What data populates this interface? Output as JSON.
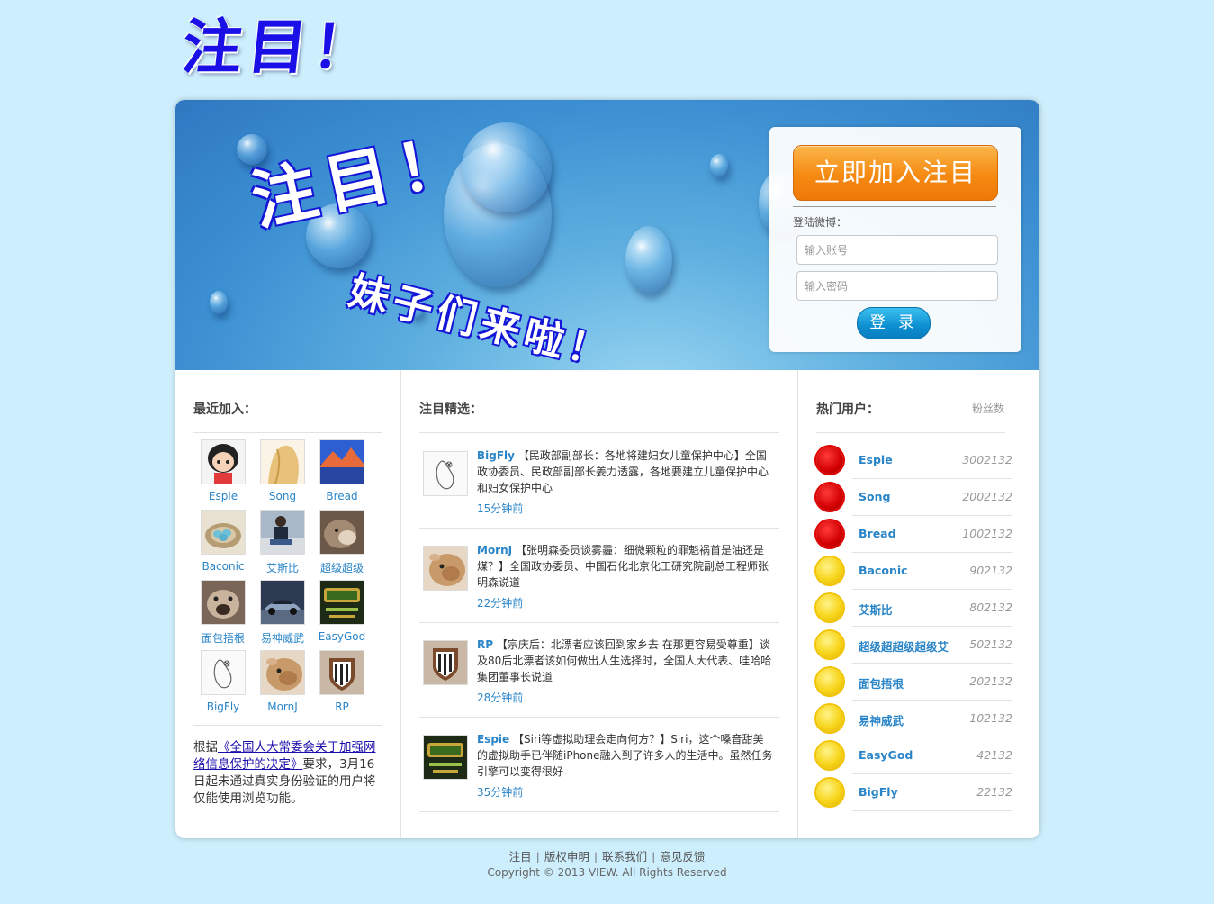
{
  "logo": {
    "text": "注目！"
  },
  "banner": {
    "title": "注目！",
    "subtitle": "妹子们来啦！"
  },
  "login": {
    "join_label": "立即加入注目",
    "section_label": "登陆微博：",
    "account_placeholder": "输入账号",
    "password_placeholder": "输入密码",
    "submit_label": "登 录"
  },
  "recent": {
    "title": "最近加入：",
    "users": [
      {
        "name": "Espie",
        "avatar": "cartoon-girl"
      },
      {
        "name": "Song",
        "avatar": "blonde-hair"
      },
      {
        "name": "Bread",
        "avatar": "mountain-lake"
      },
      {
        "name": "Baconic",
        "avatar": "blue-eggs-nest"
      },
      {
        "name": "艾斯比",
        "avatar": "person-sitting"
      },
      {
        "name": "超级超级",
        "avatar": "cat-closeup"
      },
      {
        "name": "面包捂根",
        "avatar": "dog-closeup"
      },
      {
        "name": "易神威武",
        "avatar": "sports-car"
      },
      {
        "name": "EasyGod",
        "avatar": "game-logo"
      },
      {
        "name": "BigFly",
        "avatar": "sketch-bird"
      },
      {
        "name": "MornJ",
        "avatar": "alpaca"
      },
      {
        "name": "RP",
        "avatar": "juventus-crest"
      }
    ],
    "notice_prefix": "根据",
    "notice_link": "《全国人大常委会关于加强网络信息保护的决定》",
    "notice_suffix": "要求，3月16日起未通过真实身份验证的用户将仅能使用浏览功能。"
  },
  "featured": {
    "title": "注目精选：",
    "posts": [
      {
        "author": "BigFly",
        "content": "【民政部副部长：各地将建妇女儿童保护中心】全国政协委员、民政部副部长姜力透露，各地要建立儿童保护中心和妇女保护中心",
        "time": "15分钟前",
        "avatar": "sketch-bird"
      },
      {
        "author": "MornJ",
        "content": "【张明森委员谈雾霾：细微颗粒的罪魁祸首是油还是煤？】全国政协委员、中国石化北京化工研究院副总工程师张明森说道",
        "time": "22分钟前",
        "avatar": "alpaca"
      },
      {
        "author": "RP",
        "content": "【宗庆后：北漂者应该回到家乡去 在那更容易受尊重】谈及80后北漂者该如何做出人生选择时，全国人大代表、哇哈哈集团董事长说道",
        "time": "28分钟前",
        "avatar": "juventus-crest"
      },
      {
        "author": "Espie",
        "content": "【Siri等虚拟助理会走向何方？】Siri，这个嗓音甜美的虚拟助手已伴随iPhone融入到了许多人的生活中。虽然任务引擎可以变得很好",
        "time": "35分钟前",
        "avatar": "game-logo"
      }
    ]
  },
  "hot": {
    "title": "热门用户：",
    "fans_label": "粉丝数",
    "users": [
      {
        "name": "Espie",
        "fans": "3002132",
        "badge": "red"
      },
      {
        "name": "Song",
        "fans": "2002132",
        "badge": "red"
      },
      {
        "name": "Bread",
        "fans": "1002132",
        "badge": "red"
      },
      {
        "name": "Baconic",
        "fans": "902132",
        "badge": "gold"
      },
      {
        "name": "艾斯比",
        "fans": "802132",
        "badge": "gold"
      },
      {
        "name": "超级超超级超级艾",
        "fans": "502132",
        "badge": "gold"
      },
      {
        "name": "面包捂根",
        "fans": "202132",
        "badge": "gold"
      },
      {
        "name": "易神威武",
        "fans": "102132",
        "badge": "gold"
      },
      {
        "name": "EasyGod",
        "fans": "42132",
        "badge": "gold"
      },
      {
        "name": "BigFly",
        "fans": "22132",
        "badge": "gold"
      }
    ]
  },
  "footer": {
    "links": [
      "注目",
      "版权申明",
      "联系我们",
      "意见反馈"
    ],
    "copyright": "Copyright © 2013 VIEW. All Rights Reserved"
  },
  "colors": {
    "page_bg": "#cdeefc",
    "logo_blue": "#1a0fe6",
    "link_blue": "#2a85c8",
    "join_orange": "#f58a12",
    "login_blue": "#0c8fd0"
  }
}
